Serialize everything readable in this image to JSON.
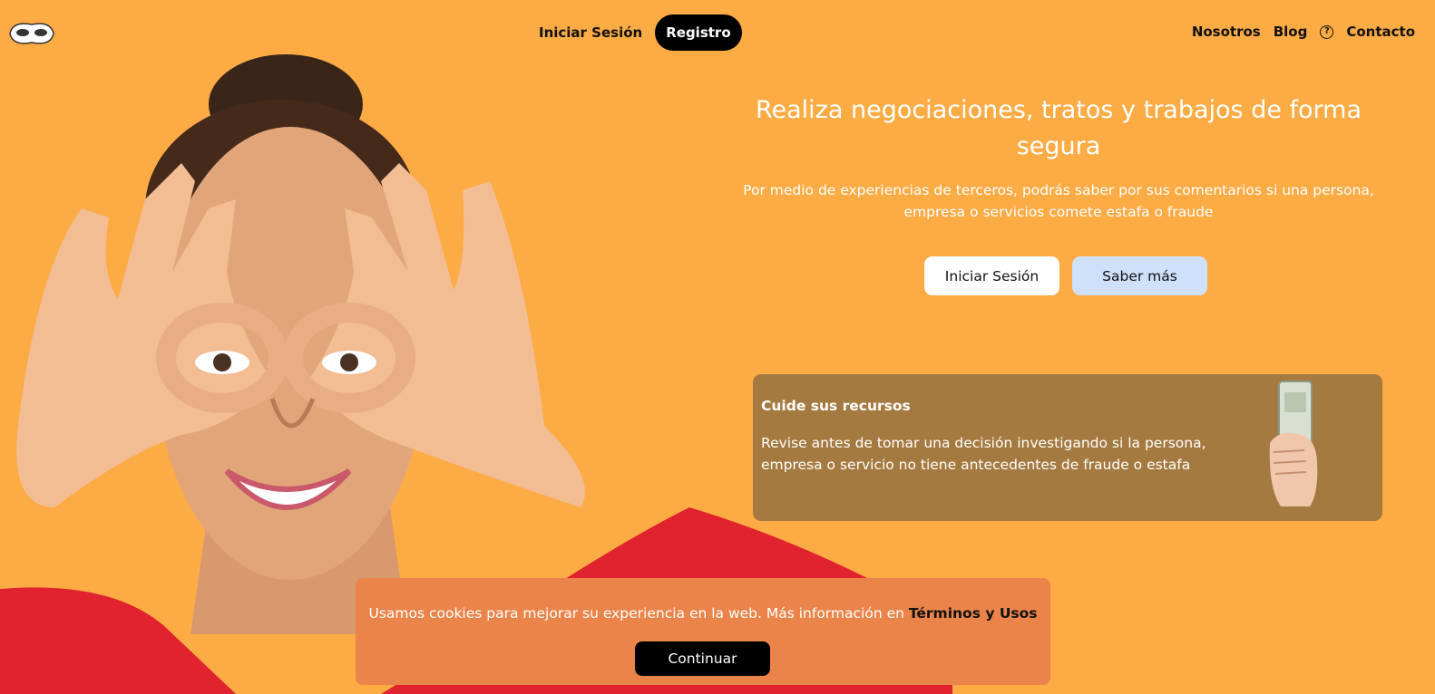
{
  "nav": {
    "login_label": "Iniciar Sesión",
    "register_label": "Registro",
    "about_label": "Nosotros",
    "blog_label": "Blog",
    "help_icon": "?",
    "contact_label": "Contacto"
  },
  "hero": {
    "title": "Realiza negociaciones, tratos y trabajos de forma segura",
    "subtitle": "Por medio de experiencias de terceros, podrás saber por sus comentarios si una persona, empresa o servicios comete estafa o fraude",
    "primary_button": "Iniciar Sesión",
    "secondary_button": "Saber más"
  },
  "card": {
    "title": "Cuide sus recursos",
    "text": "Revise antes de tomar una decisión investigando si la persona, empresa o servicio no tiene antecedentes de fraude o estafa"
  },
  "cookie": {
    "text": "Usamos cookies para mejorar su experiencia en la web. Más información en",
    "link": "Términos y Usos",
    "button": "Continuar"
  },
  "colors": {
    "background": "#fdab45",
    "card": "#a57a40",
    "cookie_banner": "#ea844a",
    "secondary_button": "#cfe0fb"
  }
}
